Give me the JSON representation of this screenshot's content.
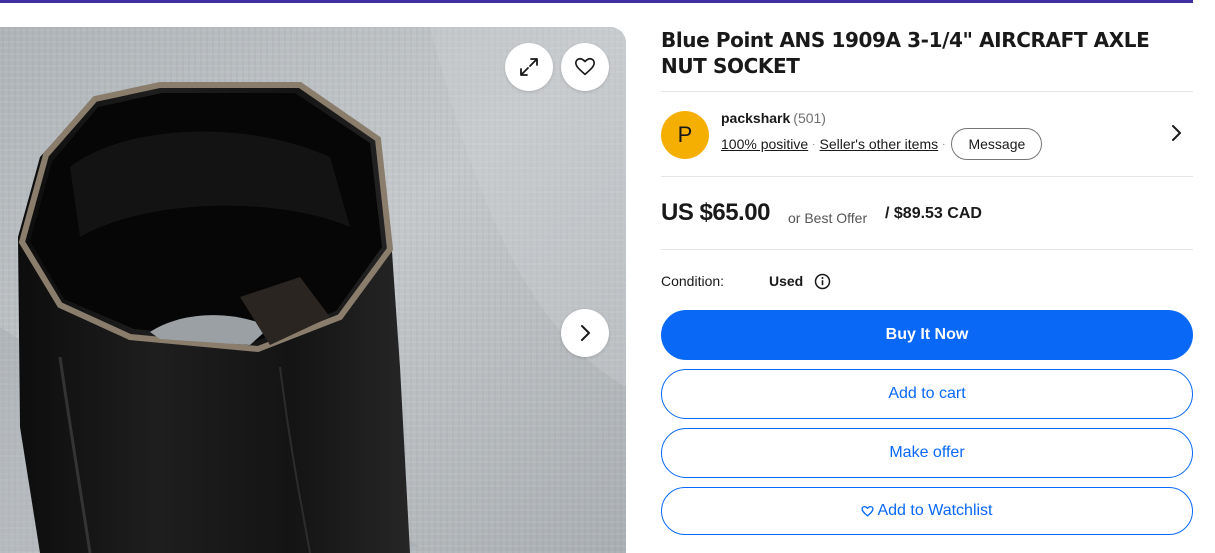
{
  "listing": {
    "title": "Blue Point ANS 1909A 3-1/4\" AIRCRAFT AXLE NUT SOCKET"
  },
  "gallery": {
    "icons": [
      "expand-icon",
      "heart-icon",
      "chevron-right-icon"
    ]
  },
  "seller": {
    "initial": "P",
    "name": "packshark",
    "feedback_count": "(501)",
    "positive": "100% positive",
    "other_items": "Seller's other items",
    "message_label": "Message"
  },
  "price": {
    "primary": "US $65.00",
    "best_offer": "or Best Offer",
    "converted": "/ $89.53 CAD"
  },
  "condition": {
    "label": "Condition:",
    "value": "Used"
  },
  "actions": {
    "buy_now": "Buy It Now",
    "add_to_cart": "Add to cart",
    "make_offer": "Make offer",
    "watchlist": "Add to Watchlist"
  },
  "colors": {
    "accent_blue": "#0968f6",
    "avatar_yellow": "#f5af02",
    "top_bar": "#3f2fa0"
  }
}
